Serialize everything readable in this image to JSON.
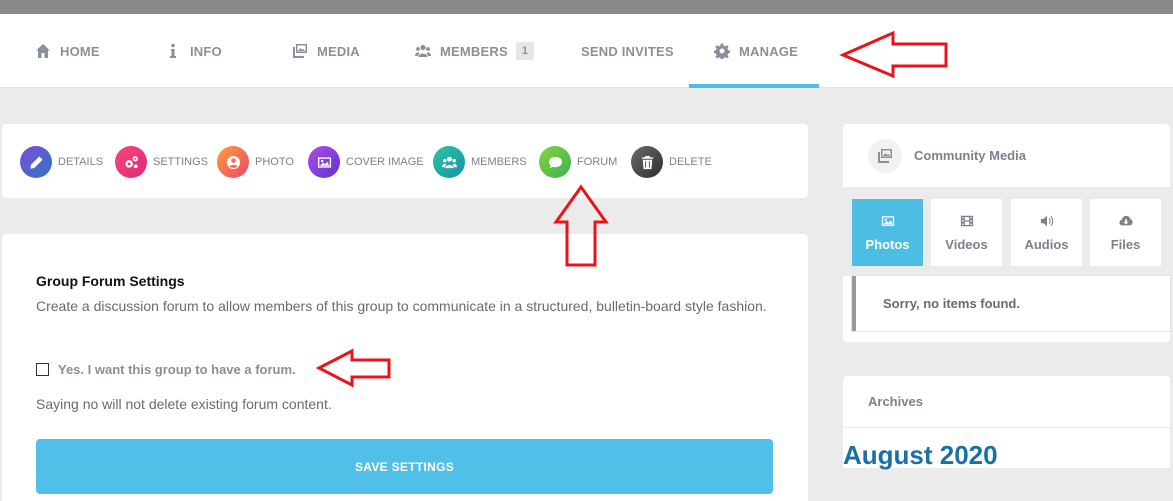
{
  "nav": {
    "items": [
      {
        "label": "HOME",
        "icon": "home-icon"
      },
      {
        "label": "INFO",
        "icon": "info-icon"
      },
      {
        "label": "MEDIA",
        "icon": "media-icon"
      },
      {
        "label": "MEMBERS",
        "icon": "members-icon",
        "badge": "1"
      },
      {
        "label": "SEND INVITES"
      },
      {
        "label": "MANAGE",
        "icon": "gear-icon",
        "active": true
      }
    ]
  },
  "subnav": {
    "items": [
      {
        "label": "DETAILS",
        "icon": "pencil-icon",
        "color": "#3b5fb8"
      },
      {
        "label": "SETTINGS",
        "icon": "cogs-icon",
        "color": "#ee3a6c"
      },
      {
        "label": "PHOTO",
        "icon": "user-circle-icon",
        "color": "#f36a3c"
      },
      {
        "label": "COVER IMAGE",
        "icon": "image-icon",
        "color": "#7b3fe0"
      },
      {
        "label": "MEMBERS",
        "icon": "members-icon",
        "color": "#1ab39a"
      },
      {
        "label": "FORUM",
        "icon": "comment-icon",
        "color": "#5cc441"
      },
      {
        "label": "DELETE",
        "icon": "trash-icon",
        "color": "#4a4a4a"
      }
    ]
  },
  "forum_settings": {
    "title": "Group Forum Settings",
    "description": "Create a discussion forum to allow members of this group to communicate in a structured, bulletin-board style fashion.",
    "checkbox_label": "Yes. I want this group to have a forum.",
    "checkbox_checked": false,
    "note": "Saying no will not delete existing forum content.",
    "save_label": "SAVE SETTINGS"
  },
  "community_media": {
    "title": "Community Media",
    "tabs": [
      {
        "label": "Photos",
        "icon": "image-icon",
        "active": true
      },
      {
        "label": "Videos",
        "icon": "film-icon"
      },
      {
        "label": "Audios",
        "icon": "volume-icon"
      },
      {
        "label": "Files",
        "icon": "cloud-download-icon"
      }
    ],
    "empty_message": "Sorry, no items found."
  },
  "archives": {
    "title": "Archives",
    "links": [
      "August 2020"
    ]
  },
  "colors": {
    "accent": "#4dbde3",
    "annotation": "#e8141c",
    "link": "#1a6fa5"
  }
}
